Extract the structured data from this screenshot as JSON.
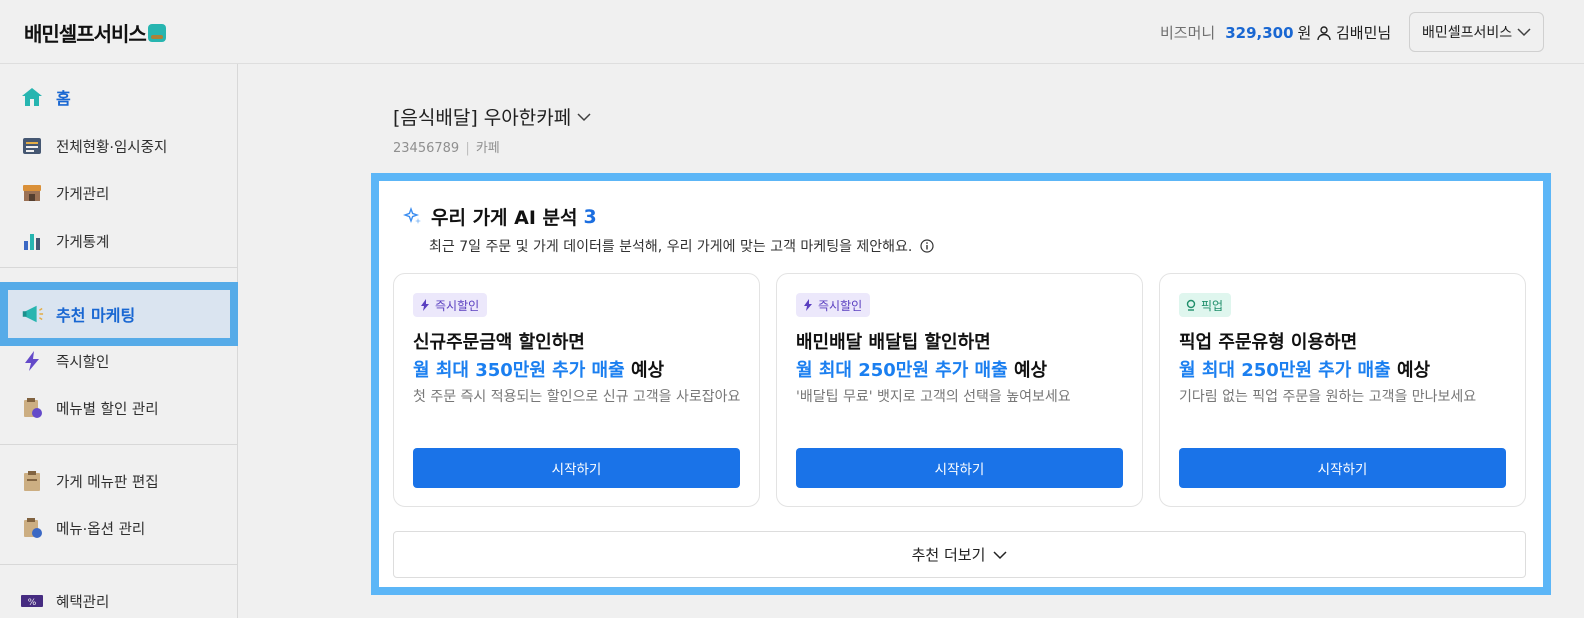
{
  "header": {
    "logo": "배민셀프서비스",
    "bizmoney_label": "비즈머니",
    "bizmoney_amount": "329,300",
    "bizmoney_unit": "원",
    "user_name": "김배민님",
    "store_select": "배민셀프서비스"
  },
  "sidebar": {
    "items": [
      {
        "label": "홈",
        "icon": "home-icon"
      },
      {
        "label": "전체현황·임시중지",
        "icon": "dashboard-icon"
      },
      {
        "label": "가게관리",
        "icon": "store-icon"
      },
      {
        "label": "가게통계",
        "icon": "bar-chart-icon"
      },
      {
        "label": "추천 마케팅",
        "icon": "megaphone-icon"
      },
      {
        "label": "즉시할인",
        "icon": "lightning-icon"
      },
      {
        "label": "메뉴별 할인 관리",
        "icon": "menu-discount-icon"
      },
      {
        "label": "가게 메뉴판 편집",
        "icon": "menu-board-icon"
      },
      {
        "label": "메뉴·옵션 관리",
        "icon": "menu-option-icon"
      },
      {
        "label": "혜택관리",
        "icon": "coupon-icon"
      }
    ]
  },
  "store": {
    "title": "[음식배달] 우아한카페",
    "id": "23456789",
    "separator": "|",
    "category": "카페"
  },
  "ai_panel": {
    "title": "우리 가게 AI 분석",
    "count": "3",
    "description": "최근 7일 주문 및 가게 데이터를 분석해, 우리 가게에 맞는 고객 마케팅을 제안해요.",
    "cards": [
      {
        "tag": "즉시할인",
        "line1": "신규주문금액 할인하면",
        "highlight": "월 최대 350만원 추가 매출",
        "suffix": " 예상",
        "desc": "첫 주문 즉시 적용되는 할인으로 신규 고객을 사로잡아요",
        "button": "시작하기"
      },
      {
        "tag": "즉시할인",
        "line1": "배민배달 배달팁 할인하면",
        "highlight": "월 최대 250만원 추가 매출",
        "suffix": " 예상",
        "desc": "'배달팁 무료' 뱃지로 고객의 선택을 높여보세요",
        "button": "시작하기"
      },
      {
        "tag": "픽업",
        "line1": "픽업 주문유형 이용하면",
        "highlight": "월 최대 250만원 추가 매출",
        "suffix": " 예상",
        "desc": "기다림 없는 픽업 주문을 원하는 고객을 만나보세요",
        "button": "시작하기"
      }
    ],
    "more_label": "추천 더보기"
  },
  "colors": {
    "accent_blue": "#1a73e8",
    "highlight_border": "#5cb6f7",
    "active_bg": "#e8f3ff"
  }
}
